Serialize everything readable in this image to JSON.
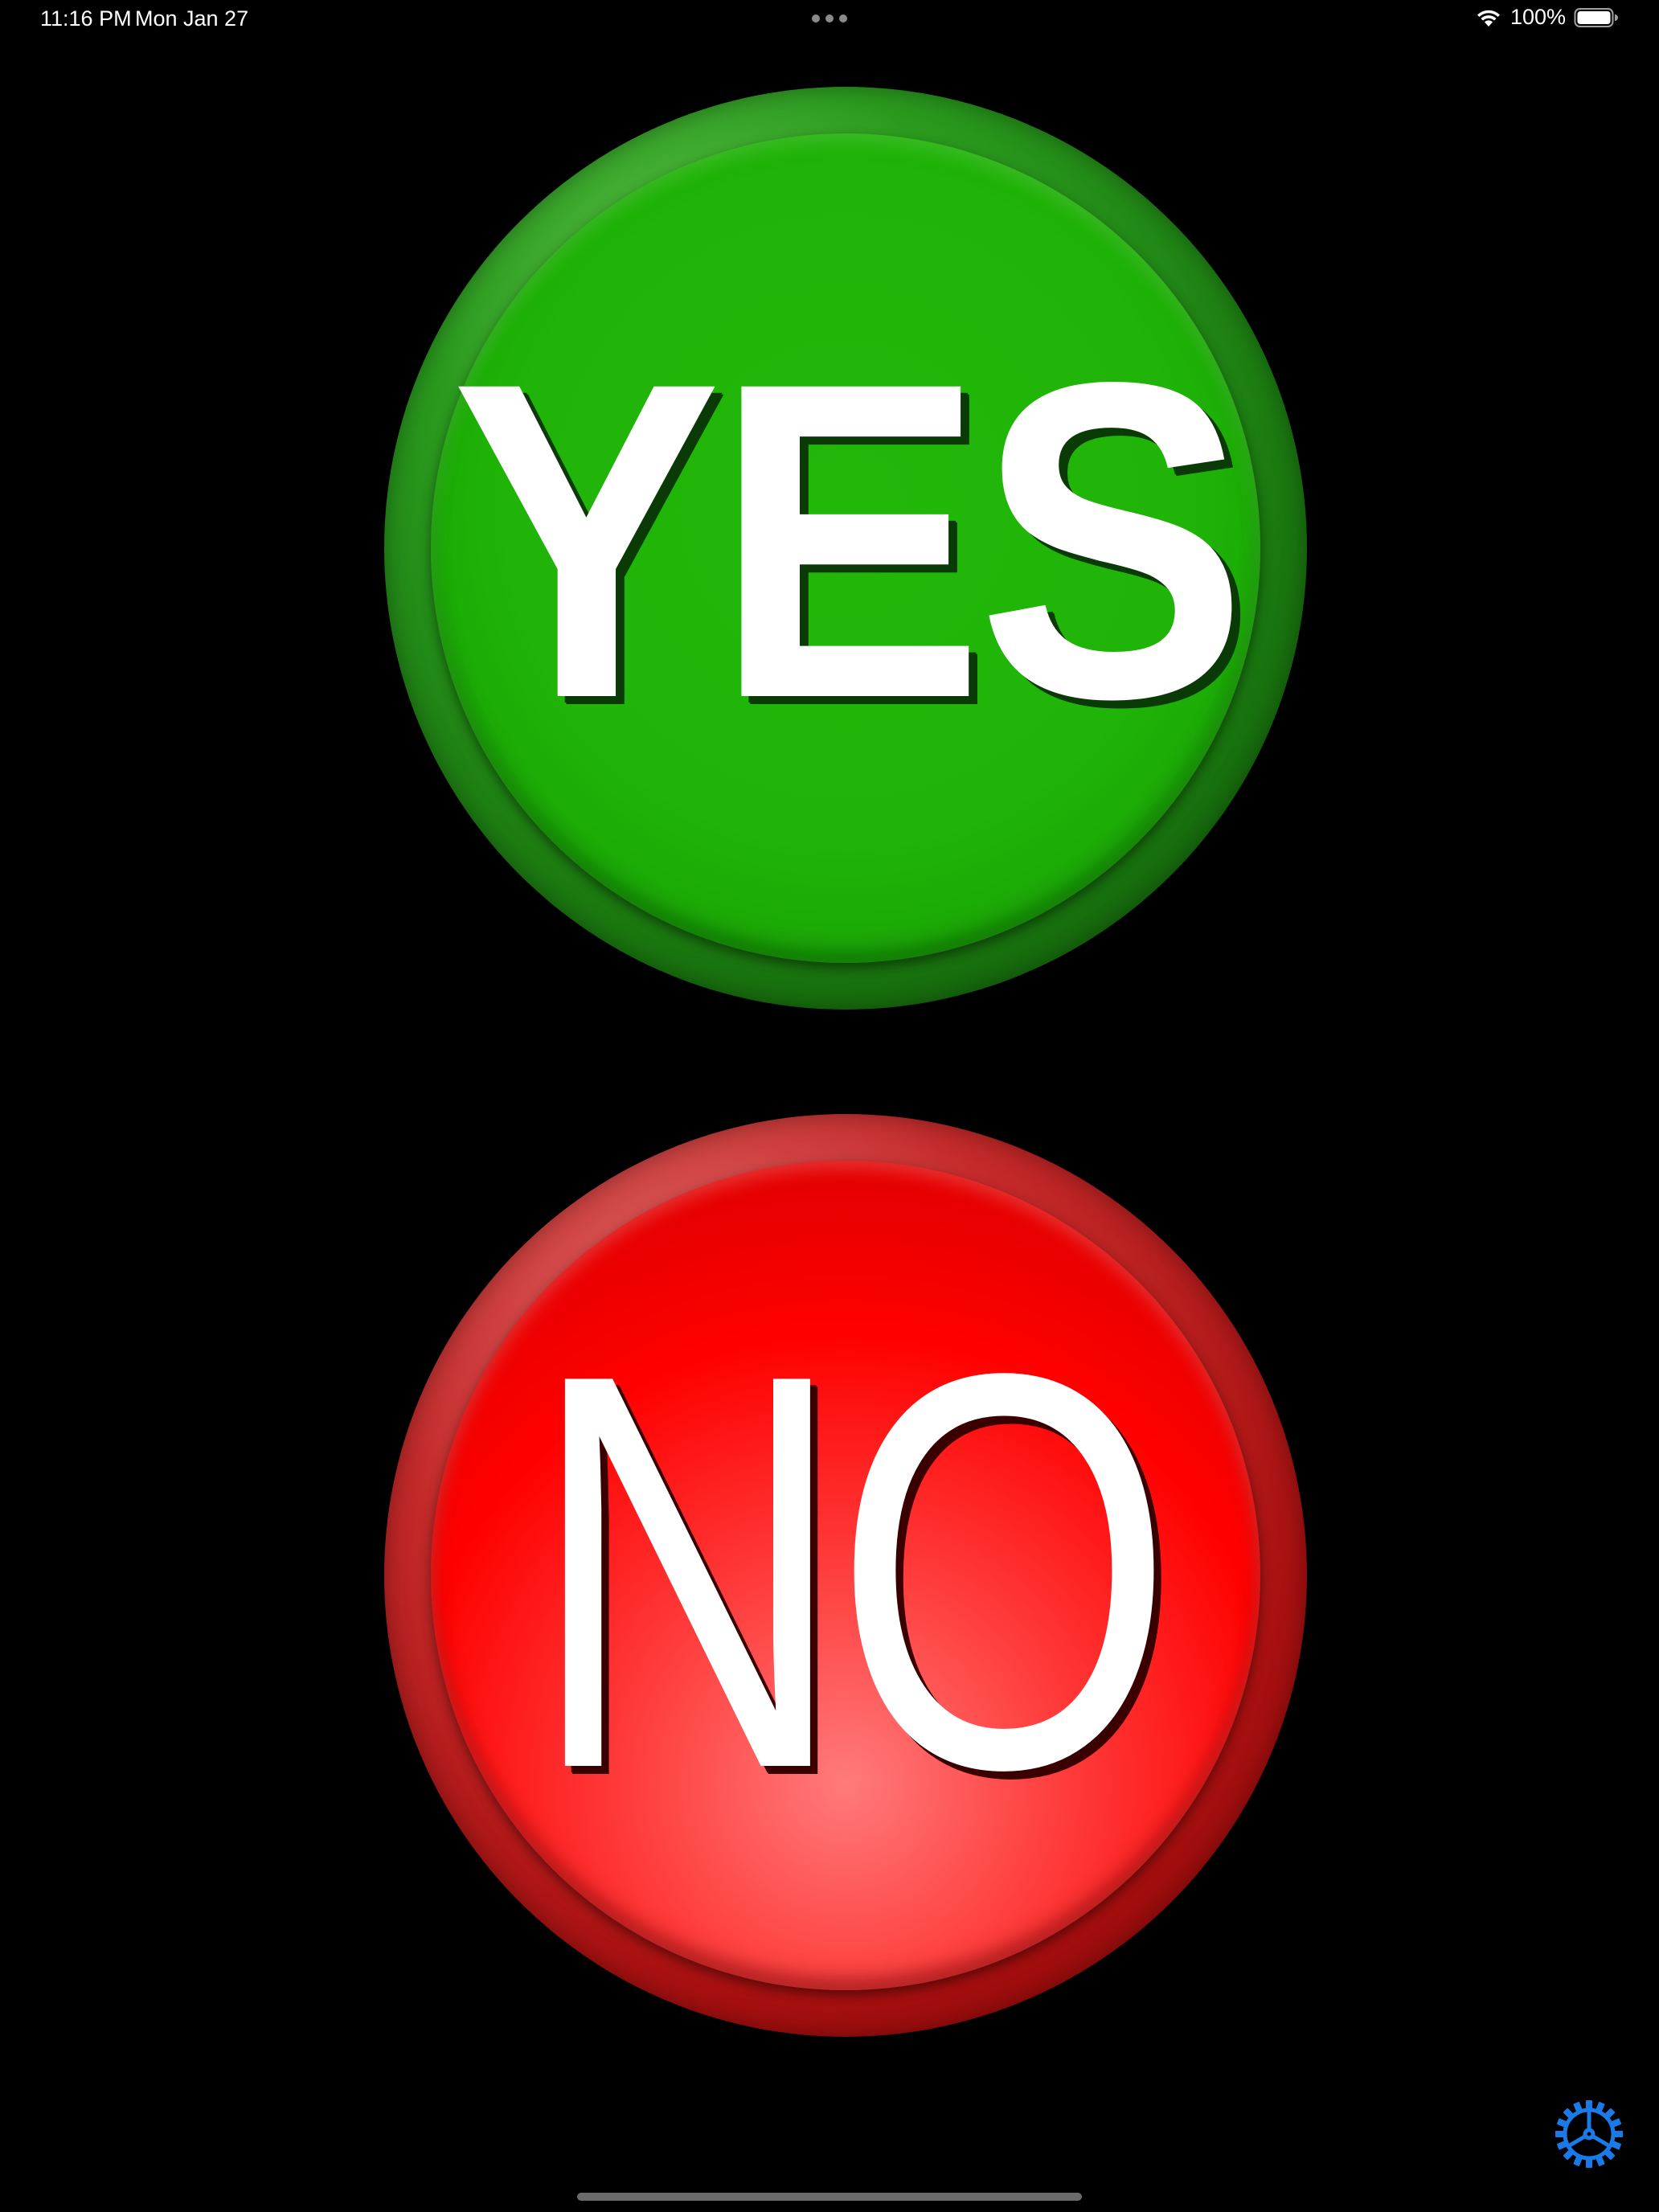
{
  "status_bar": {
    "time": "11:16 PM",
    "date": "Mon Jan 27",
    "battery": "100%"
  },
  "buttons": {
    "yes": {
      "label": "YES",
      "color": "#1fb407"
    },
    "no": {
      "label": "NO",
      "color": "#ff0000"
    }
  },
  "icons": {
    "wifi": "wifi-icon",
    "battery": "battery-icon",
    "settings": "gear-icon",
    "multitask": "more-dots-icon"
  },
  "accent_color": "#1a7ae8"
}
